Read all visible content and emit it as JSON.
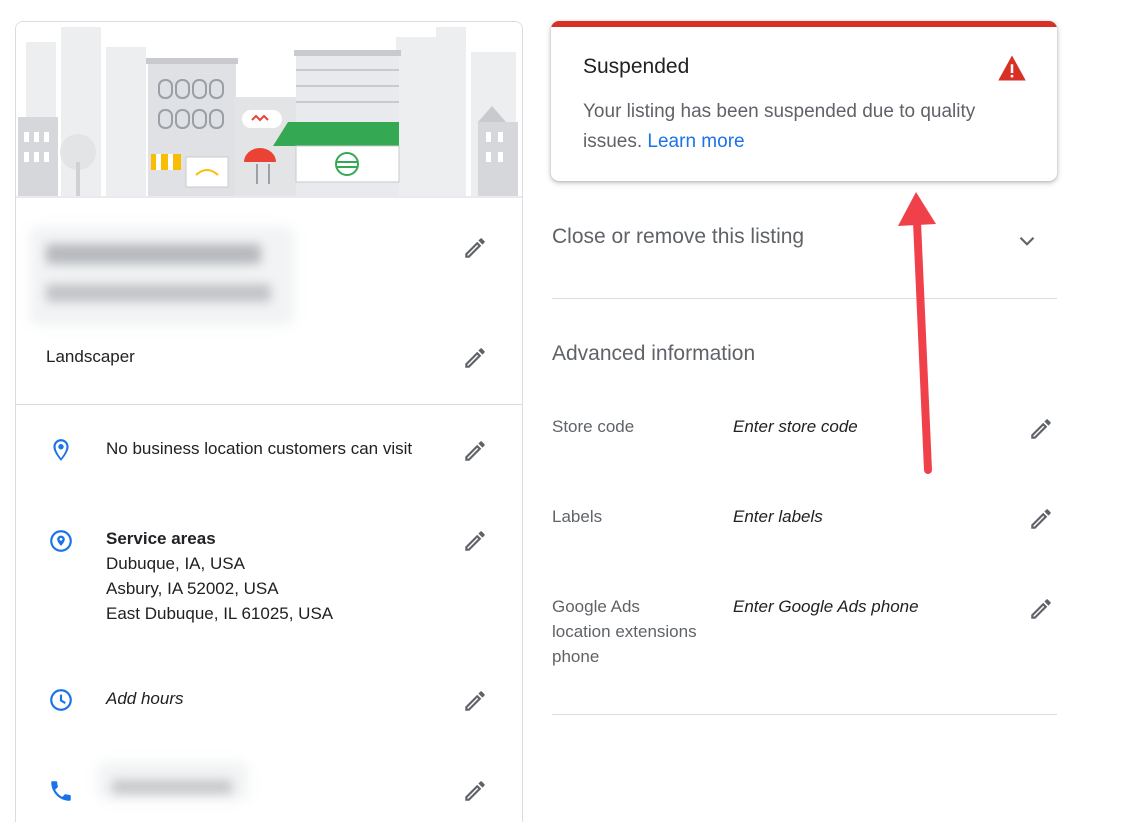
{
  "left_card": {
    "category": "Landscaper",
    "location": "No business location customers can visit",
    "service_areas": {
      "title": "Service areas",
      "lines": [
        "Dubuque, IA, USA",
        "Asbury, IA 52002, USA",
        "East Dubuque, IL 61025, USA"
      ]
    },
    "hours": "Add hours"
  },
  "status_card": {
    "title": "Suspended",
    "message": "Your listing has been suspended due to quality issues.",
    "link": "Learn more",
    "accent": "#d93025"
  },
  "close_section": {
    "label": "Close or remove this listing"
  },
  "advanced": {
    "title": "Advanced information",
    "rows": [
      {
        "label": "Store code",
        "value": "Enter store code"
      },
      {
        "label": "Labels",
        "value": "Enter labels"
      },
      {
        "label": "Google Ads location extensions phone",
        "value": "Enter Google Ads phone"
      }
    ]
  },
  "colors": {
    "link": "#1a73e8",
    "icon_blue": "#1a73e8",
    "arrow": "#f0414b",
    "muted": "#5f6368"
  }
}
